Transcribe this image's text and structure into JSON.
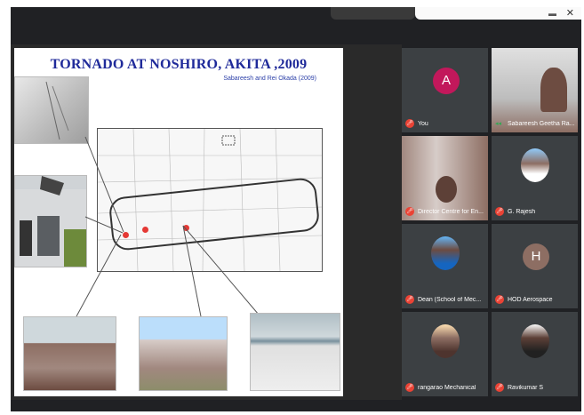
{
  "slide": {
    "title": "TORNADO AT NOSHIRO, AKITA ,2009",
    "subtitle": "Sabareesh and Rei Okada (2009)"
  },
  "participants": [
    {
      "name": "You",
      "avatar_letter": "A",
      "avatar_color": "#c2185b",
      "mic": "muted",
      "kind": "letter"
    },
    {
      "name": "Sabareesh Geetha Ra...",
      "mic": "speaking",
      "kind": "video"
    },
    {
      "name": "Director Centre for En...",
      "mic": "muted",
      "kind": "video"
    },
    {
      "name": "G. Rajesh",
      "mic": "muted",
      "kind": "photo"
    },
    {
      "name": "Dean (School of Mec...",
      "mic": "muted",
      "kind": "photo"
    },
    {
      "name": "HOD Aerospace",
      "avatar_letter": "H",
      "avatar_color": "#8d6e63",
      "mic": "muted",
      "kind": "letter"
    },
    {
      "name": "rangarao Mechanical",
      "mic": "muted",
      "kind": "photo"
    },
    {
      "name": "Ravikumar S",
      "mic": "muted",
      "kind": "photo"
    }
  ],
  "icons": {
    "mute": "mic-off-icon",
    "speaking": "audio-level-icon",
    "close": "close-icon"
  }
}
